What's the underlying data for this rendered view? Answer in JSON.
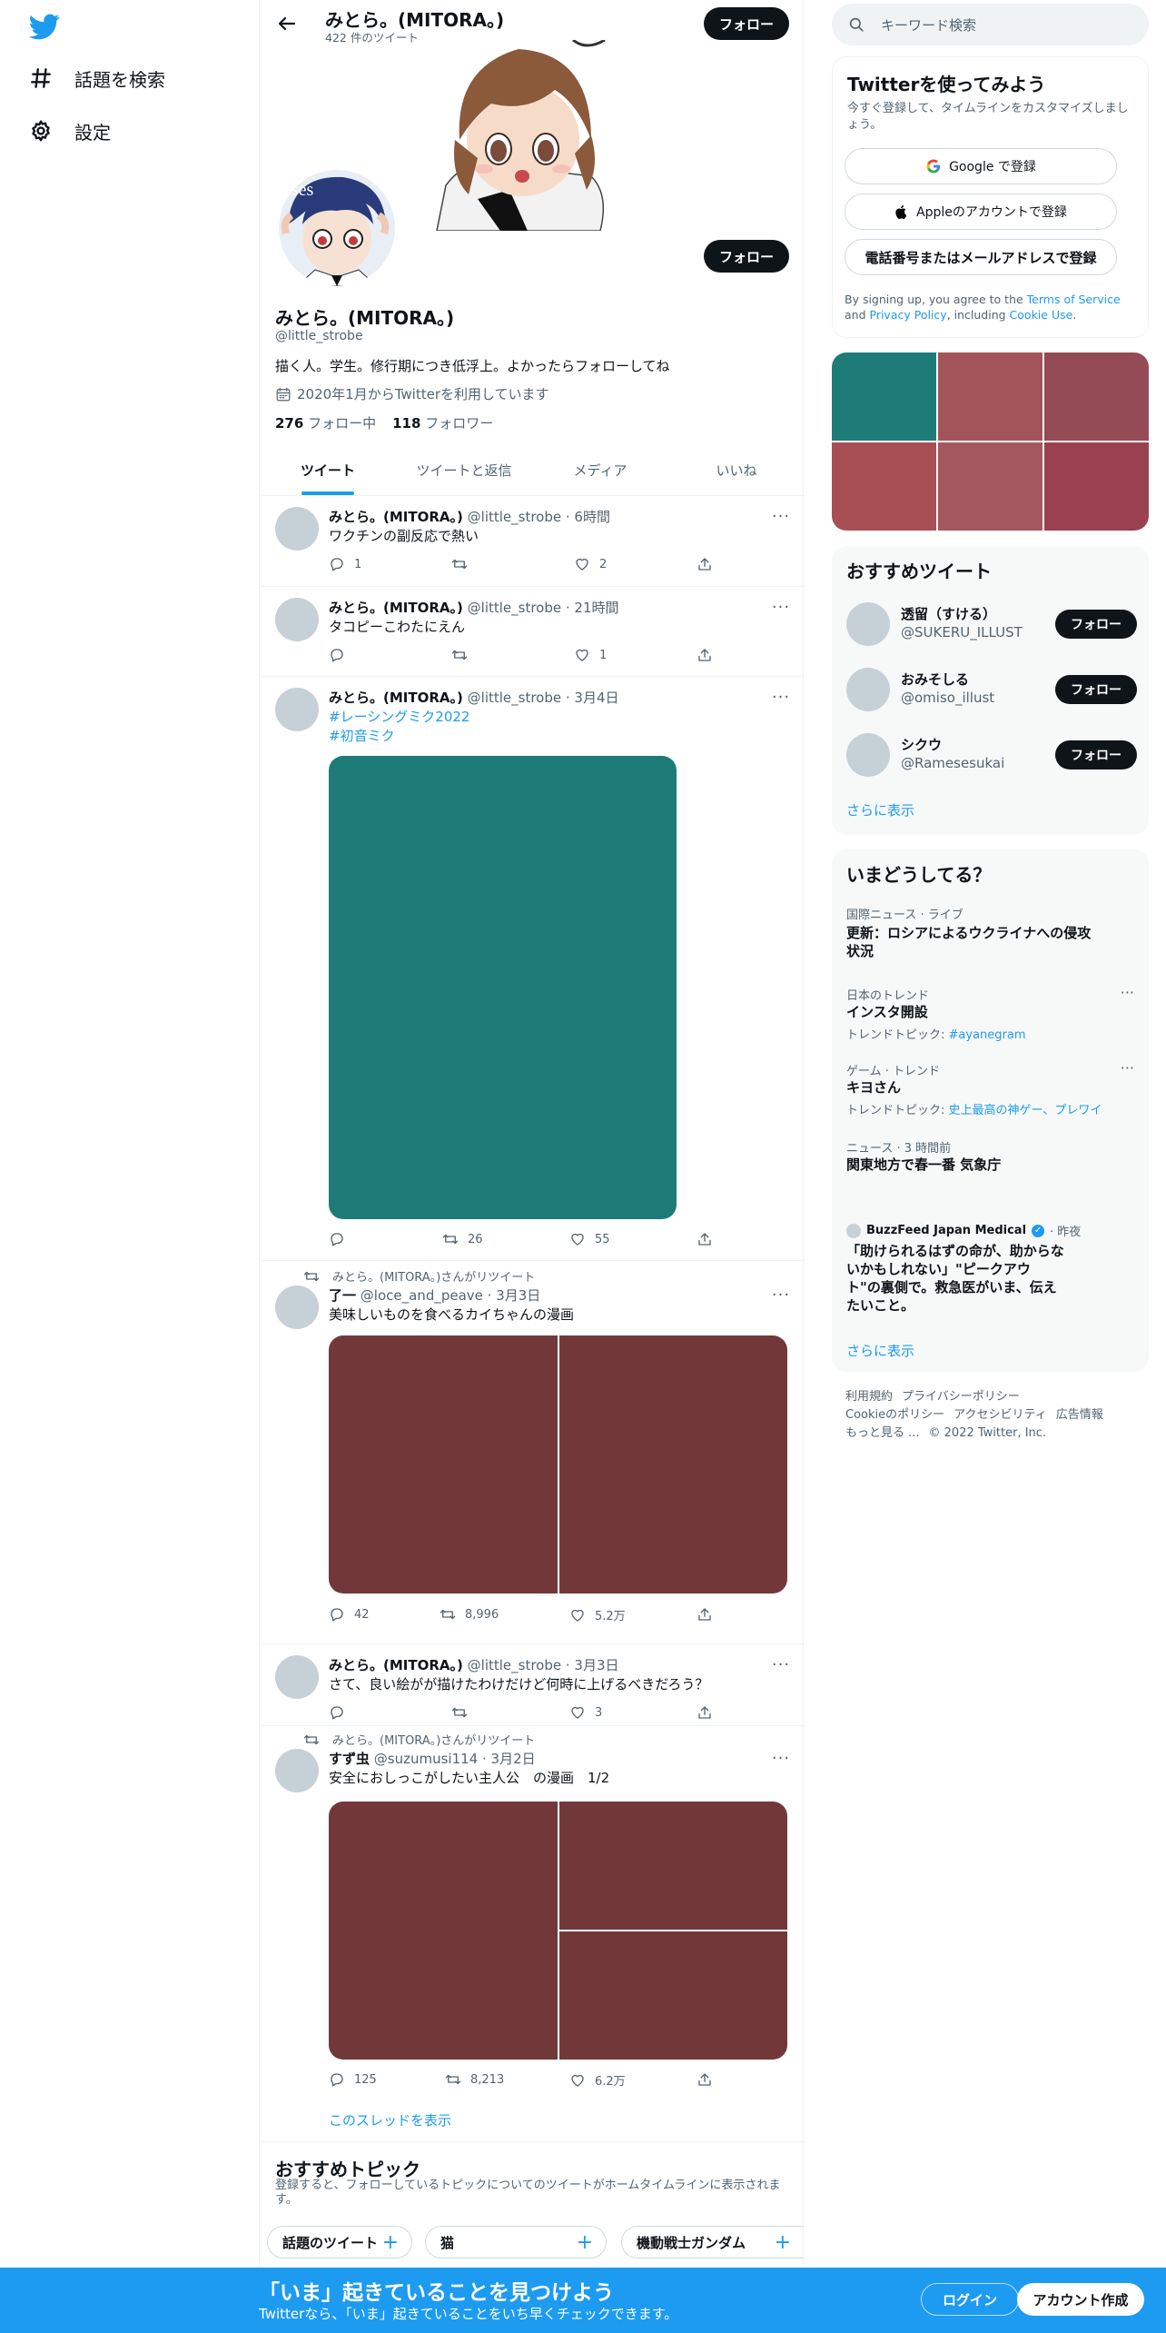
{
  "nav": {
    "logo_icon": "twitter-bird-icon",
    "items": [
      {
        "label": "話題を検索",
        "icon": "hashtag-icon"
      },
      {
        "label": "設定",
        "icon": "gear-icon"
      }
    ]
  },
  "header": {
    "name": "みとら。(MITORA。)",
    "tweet_count": "422 件のツイート",
    "follow_label": "フォロー"
  },
  "profile": {
    "name": "みとら。(MITORA。)",
    "handle": "@little_strobe",
    "bio": "描く人。学生。修行期につき低浮上。よかったらフォローしてね",
    "joined": "2020年1月からTwitterを利用しています",
    "following_count": "276",
    "following_label": "フォロー中",
    "followers_count": "118",
    "followers_label": "フォロワー",
    "follow_label": "フォロー",
    "avatar_text": "sses"
  },
  "tabs": [
    "ツイート",
    "ツイートと返信",
    "メディア",
    "いいね"
  ],
  "tweets": [
    {
      "name": "みとら。(MITORA。)",
      "meta": "@little_strobe · 6時間",
      "text": "ワクチンの副反応で熱い",
      "reply": "1",
      "retweet": "",
      "like": "2"
    },
    {
      "name": "みとら。(MITORA。)",
      "meta": "@little_strobe · 21時間",
      "text": "タコピーこわたにえん",
      "reply": "",
      "retweet": "",
      "like": "1"
    },
    {
      "name": "みとら。(MITORA。)",
      "meta": "@little_strobe · 3月4日",
      "tag1": "#レーシングミク2022",
      "tag2": "#初音ミク",
      "reply": "",
      "retweet": "26",
      "like": "55",
      "media_color": "#1e7c78"
    },
    {
      "retweeted_by": "みとら。(MITORA。)さんがリツイート",
      "name": "了一",
      "meta": "@loce_and_peave · 3月3日",
      "text": "美味しいものを食べるカイちゃんの漫画",
      "reply": "42",
      "retweet": "8,996",
      "like": "5.2万",
      "media_color": "#723839"
    },
    {
      "name": "みとら。(MITORA。)",
      "meta": "@little_strobe · 3月3日",
      "text": "さて、良い絵がが描けたわけだけど何時に上げるべきだろう？",
      "reply": "",
      "retweet": "",
      "like": "3"
    },
    {
      "retweeted_by": "みとら。(MITORA。)さんがリツイート",
      "name": "すず虫",
      "meta": "@suzumusi114 · 3月2日",
      "text": "安全におしっこがしたい主人公　の漫画　1/2",
      "reply": "125",
      "retweet": "8,213",
      "like": "6.2万",
      "media_color": "#723839",
      "thread_link": "このスレッドを表示"
    }
  ],
  "topics": {
    "title": "おすすめトピック",
    "subtitle": "登録すると、フォローしているトピックについてのツイートがホームタイムラインに表示されます。",
    "items": [
      "話題のツイート",
      "猫",
      "機動戦士ガンダム"
    ]
  },
  "search": {
    "placeholder": "キーワード検索"
  },
  "signup": {
    "title": "Twitterを使ってみよう",
    "subtitle": "今すぐ登録して、タイムラインをカスタマイズしましょう。",
    "google": "Google で登録",
    "apple": "Appleのアカウントで登録",
    "phone": "電話番号またはメールアドレスで登録",
    "legal_pre": "By signing up, you agree to the ",
    "legal_tos": "Terms of Service",
    "legal_and": " and ",
    "legal_pp": "Privacy Policy",
    "legal_inc": ", including ",
    "legal_cookie": "Cookie Use",
    "legal_end": "."
  },
  "mosaic_colors": [
    "#1e7c78",
    "#a3545b",
    "#944b55",
    "#a84f55",
    "#a3575e",
    "#9a4150"
  ],
  "recommended": {
    "title": "おすすめツイート",
    "users": [
      {
        "name": "透留（すける）",
        "handle": "@SUKERU_ILLUST"
      },
      {
        "name": "おみそしる",
        "handle": "@omiso_illust"
      },
      {
        "name": "シクウ",
        "handle": "@Ramesesukai"
      }
    ],
    "follow_label": "フォロー",
    "show_more": "さらに表示"
  },
  "trends": {
    "title": "いまどうしてる？",
    "items": [
      {
        "category": "国際ニュース · ライブ",
        "name": "更新：ロシアによるウクライナへの侵攻状況"
      },
      {
        "category": "日本のトレンド",
        "name": "インスタ開設",
        "sub_label": "トレンドトピック: ",
        "sub_link": "#ayanegram"
      },
      {
        "category": "ゲーム · トレンド",
        "name": "キヨさん",
        "sub_label": "トレンドトピック: ",
        "sub_link": "史上最高の神ゲー、プレワイ"
      },
      {
        "category": "ニュース · 3 時間前",
        "name": "関東地方で春一番 気象庁"
      }
    ],
    "news": {
      "source": "BuzzFeed Japan Medical",
      "time": " · 昨夜",
      "headline": "「助けられるはずの命が、助からないかもしれない」\"ピークアウト\"の裏側で。救急医がいま、伝えたいこと。"
    },
    "show_more": "さらに表示"
  },
  "footer": {
    "links": [
      "利用規約",
      "プライバシーポリシー",
      "Cookieのポリシー",
      "アクセシビリティ",
      "広告情報",
      "もっと見る ...",
      "© 2022 Twitter, Inc."
    ]
  },
  "bottom_bar": {
    "title": "「いま」起きていることを見つけよう",
    "subtitle": "Twitterなら、「いま」起きていることをいち早くチェックできます。",
    "login": "ログイン",
    "signup": "アカウント作成"
  }
}
